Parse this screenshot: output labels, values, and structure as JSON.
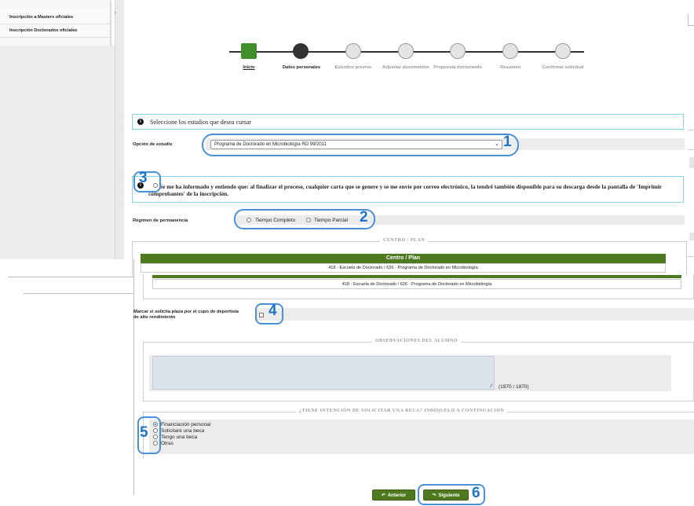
{
  "sidebar": {
    "items": [
      {
        "label": "Inscripción a Masters oficiales"
      },
      {
        "label": "Inscripción Doctorados oficiales"
      }
    ],
    "collapse_icon": "chevron-left-icon"
  },
  "stepper": {
    "steps": [
      {
        "label": "Inicio",
        "state": "done"
      },
      {
        "label": "Datos personales",
        "state": "current"
      },
      {
        "label": "Estudios previos",
        "state": "pending"
      },
      {
        "label": "Adjuntar documentos",
        "state": "pending"
      },
      {
        "label": "Propuesta doctorando",
        "state": "pending"
      },
      {
        "label": "Resumen",
        "state": "pending"
      },
      {
        "label": "Confirmar solicitud",
        "state": "pending"
      }
    ],
    "colors": {
      "done": "#3f8f2a",
      "current": "#333333",
      "pending": "#e4e4e4"
    }
  },
  "info_select": {
    "icon": "info-icon",
    "text": "Seleccione los estudios que desea cursar"
  },
  "study_option": {
    "label": "Opción de estudio",
    "value": "Programa de Doctorado en Microbiología RD 99/2011"
  },
  "notice": {
    "icon": "info-icon",
    "text": "Se me ha informado y entiendo que: al finalizar el proceso, cualquier carta que se genere y se me envíe por correo electrónico, la tendré también disponible para su descarga desde la pantalla de 'Imprimir comprobantes' de la inscripción."
  },
  "permanence": {
    "label": "Régimen de permanencia",
    "options": [
      "Tiempo Completo",
      "Tiempo Parcial"
    ]
  },
  "centro": {
    "legend": "CENTRO / PLAN",
    "header": "Centro / Plan",
    "rows": [
      "418 - Escuela de Doctorado / 626 - Programa de Doctorado en Microbiología"
    ],
    "row_repeat": "418 - Escuela de Doctorado / 626 - Programa de Doctorado en Microbiología"
  },
  "athlete": {
    "label": "Marcar si solicita plaza por el cupo de deportista de alto rendimiento"
  },
  "observations": {
    "legend": "OBSERVACIONES DEL ALUMNO",
    "counter": "(1970 / 1970)"
  },
  "beca": {
    "legend": "¿TIENE INTENCIÓN DE SOLICITAR UNA BECA? INDÍQUELO A CONTINUACIÓN",
    "options": [
      "Financiación personal",
      "Solicitaré una beca",
      "Tengo una beca",
      "Otras"
    ],
    "selected": 0
  },
  "buttons": {
    "prev": "Anterior",
    "next": "Siguiente"
  },
  "callouts": [
    "1",
    "2",
    "3",
    "4",
    "5",
    "6"
  ],
  "accent": "#4d7a1f",
  "callout_color": "#1e73c8"
}
